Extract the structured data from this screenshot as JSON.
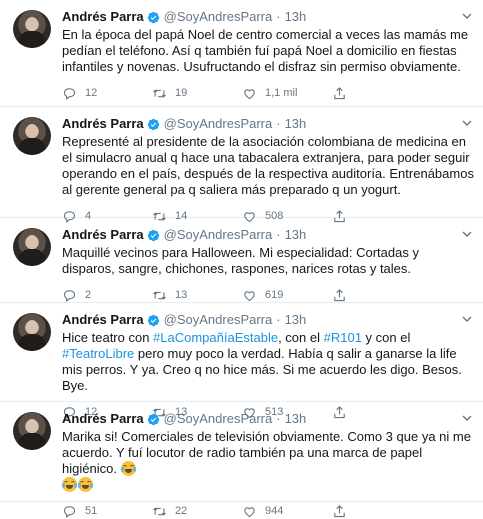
{
  "colors": {
    "link": "#1b95e0",
    "verified": "#1da1f2",
    "muted": "#657786",
    "divider": "#e6ecf0"
  },
  "tweets": [
    {
      "name": "Andrés Parra",
      "handle": "@SoyAndresParra",
      "dot": "·",
      "time": "13h",
      "text_parts": [
        "En la época del papá Noel de centro comercial a veces las mamás me pedían el teléfono. Así q también fuí papá Noel a domicilio en fiestas infantiles y novenas. Usufructando el disfraz sin permiso obviamente."
      ],
      "replies": "12",
      "retweets": "19",
      "likes": "1,1 mil"
    },
    {
      "name": "Andrés Parra",
      "handle": "@SoyAndresParra",
      "dot": "·",
      "time": "13h",
      "text_parts": [
        "Representé al presidente de la asociación colombiana de medicina en el simulacro anual q hace una tabacalera extranjera, para poder seguir operando en el país, después de la respectiva auditoría. Entrenábamos al gerente general pa q saliera más preparado q un yogurt."
      ],
      "replies": "4",
      "retweets": "14",
      "likes": "508"
    },
    {
      "name": "Andrés Parra",
      "handle": "@SoyAndresParra",
      "dot": "·",
      "time": "13h",
      "text_parts": [
        "Maquillé vecinos para Halloween. Mi especialidad: Cortadas y disparos, sangre, chichones, raspones, narices rotas y tales."
      ],
      "replies": "2",
      "retweets": "13",
      "likes": "619"
    },
    {
      "name": "Andrés Parra",
      "handle": "@SoyAndresParra",
      "dot": "·",
      "time": "13h",
      "text_parts": [
        "Hice teatro con ",
        "#LaCompañíaEstable",
        ", con el ",
        "#R101",
        " y con el ",
        "#TeatroLibre",
        " pero muy poco la verdad. Había q salir a ganarse la life mis perros. Y ya. Creo q no hice más. Si me acuerdo les digo. Besos. Bye."
      ],
      "replies": "12",
      "retweets": "13",
      "likes": "513"
    },
    {
      "name": "Andrés Parra",
      "handle": "@SoyAndresParra",
      "dot": "·",
      "time": "13h",
      "text_parts": [
        "Marika si! Comerciales de televisión obviamente. Como 3 que ya ni me acuerdo. Y fuí locutor de radio también pa una marca de papel higiénico. "
      ],
      "emojis": [
        "face-with-tears-of-joy",
        "face-with-tears-of-joy",
        "face-with-tears-of-joy"
      ],
      "replies": "51",
      "retweets": "22",
      "likes": "944"
    }
  ]
}
